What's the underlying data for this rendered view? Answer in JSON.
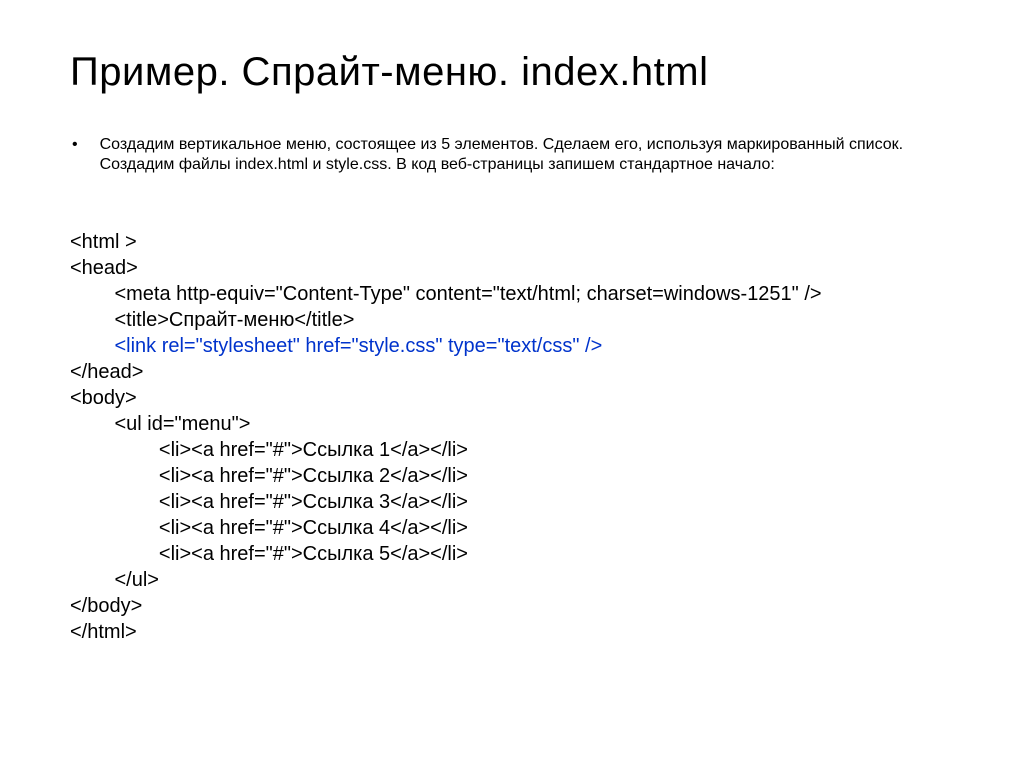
{
  "title": "Пример. Спрайт-меню. index.html",
  "bullet": "•",
  "intro": "Создадим вертикальное меню, состоящее из 5 элементов. Сделаем его, используя маркированный список. Создадим файлы index.html и style.css. В код веб-страницы запишем стандартное начало:",
  "code": {
    "l1": "<html >",
    "l2": "<head>",
    "l3": "        <meta http-equiv=\"Content-Type\" content=\"text/html; charset=windows-1251\" />",
    "l4": "        <title>Спрайт-меню</title>",
    "l5": "        <link rel=\"stylesheet\" href=\"style.css\" type=\"text/css\" />",
    "l6": "</head>",
    "l7": "<body>",
    "l8": "        <ul id=\"menu\">",
    "l9": "                <li><a href=\"#\">Ссылка 1</a></li>",
    "l10": "                <li><a href=\"#\">Ссылка 2</a></li>",
    "l11": "                <li><a href=\"#\">Ссылка 3</a></li>",
    "l12": "                <li><a href=\"#\">Ссылка 4</a></li>",
    "l13": "                <li><a href=\"#\">Ссылка 5</a></li>",
    "l14": "        </ul>",
    "l15": "</body>",
    "l16": "</html>"
  }
}
